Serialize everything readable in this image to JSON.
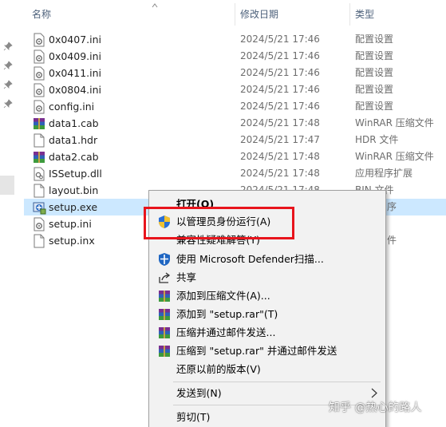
{
  "header": {
    "name": "名称",
    "date": "修改日期",
    "type": "类型"
  },
  "files": [
    {
      "name": "0x0407.ini",
      "date": "2024/5/21 17:46",
      "type": "配置设置",
      "icon": "ini-file-icon"
    },
    {
      "name": "0x0409.ini",
      "date": "2024/5/21 17:46",
      "type": "配置设置",
      "icon": "ini-file-icon"
    },
    {
      "name": "0x0411.ini",
      "date": "2024/5/21 17:46",
      "type": "配置设置",
      "icon": "ini-file-icon"
    },
    {
      "name": "0x0804.ini",
      "date": "2024/5/21 17:46",
      "type": "配置设置",
      "icon": "ini-file-icon"
    },
    {
      "name": "config.ini",
      "date": "2024/5/21 17:46",
      "type": "配置设置",
      "icon": "ini-file-icon"
    },
    {
      "name": "data1.cab",
      "date": "2024/5/21 17:48",
      "type": "WinRAR 压缩文件",
      "icon": "winrar-archive-icon"
    },
    {
      "name": "data1.hdr",
      "date": "2024/5/21 17:47",
      "type": "HDR 文件",
      "icon": "blank-file-icon"
    },
    {
      "name": "data2.cab",
      "date": "2024/5/21 17:48",
      "type": "WinRAR 压缩文件",
      "icon": "winrar-archive-icon"
    },
    {
      "name": "ISSetup.dll",
      "date": "2024/5/21 17:48",
      "type": "应用程序扩展",
      "icon": "dll-file-icon"
    },
    {
      "name": "layout.bin",
      "date": "2024/5/21 17:48",
      "type": "BIN 文件",
      "icon": "blank-file-icon"
    },
    {
      "name": "setup.exe",
      "date": "",
      "type": "序",
      "icon": "setup-exe-icon",
      "selected": true
    },
    {
      "name": "setup.ini",
      "date": "",
      "type": "",
      "icon": "ini-file-icon"
    },
    {
      "name": "setup.inx",
      "date": "",
      "type": "件",
      "icon": "blank-file-icon"
    }
  ],
  "context_menu": {
    "items": [
      {
        "label": "打开(O)",
        "icon": ""
      },
      {
        "label": "以管理员身份运行(A)",
        "icon": "uac-shield-icon"
      },
      {
        "label": "兼容性疑难解答(Y)",
        "icon": ""
      },
      {
        "label": "使用 Microsoft Defender扫描...",
        "icon": "defender-shield-icon"
      },
      {
        "label": "共享",
        "icon": "share-icon"
      },
      {
        "label": "添加到压缩文件(A)...",
        "icon": "winrar-icon"
      },
      {
        "label": "添加到 \"setup.rar\"(T)",
        "icon": "winrar-icon"
      },
      {
        "label": "压缩并通过邮件发送...",
        "icon": "winrar-icon"
      },
      {
        "label": "压缩到 \"setup.rar\" 并通过邮件发送",
        "icon": "winrar-icon"
      },
      {
        "label": "还原以前的版本(V)",
        "icon": ""
      },
      {
        "label": "发送到(N)",
        "icon": ""
      },
      {
        "label": "剪切(T)",
        "icon": ""
      }
    ]
  },
  "watermark": "知乎 @热心的路人",
  "colors": {
    "selection": "#cce8ff",
    "highlight_border": "#e8141c",
    "header_text": "#4c607a"
  }
}
